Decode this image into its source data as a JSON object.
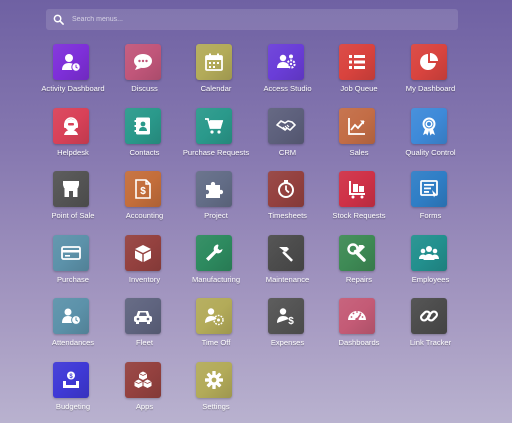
{
  "search": {
    "placeholder": "Search menus..."
  },
  "apps": [
    {
      "label": "Activity Dashboard",
      "icon": "activity-dashboard-icon",
      "color": "#7e2fd9"
    },
    {
      "label": "Discuss",
      "icon": "discuss-icon",
      "color": "#c1567a"
    },
    {
      "label": "Calendar",
      "icon": "calendar-icon",
      "color": "#b3ab59"
    },
    {
      "label": "Access Studio",
      "icon": "access-studio-icon",
      "color": "#6a3dd8"
    },
    {
      "label": "Job Queue",
      "icon": "job-queue-icon",
      "color": "#d9433e"
    },
    {
      "label": "My Dashboard",
      "icon": "my-dashboard-icon",
      "color": "#d9443f"
    },
    {
      "label": "Helpdesk",
      "icon": "helpdesk-icon",
      "color": "#d94158"
    },
    {
      "label": "Contacts",
      "icon": "contacts-icon",
      "color": "#2a998b"
    },
    {
      "label": "Purchase Requests",
      "icon": "purchase-requests-icon",
      "color": "#2a998b"
    },
    {
      "label": "CRM",
      "icon": "crm-icon",
      "color": "#5d607c"
    },
    {
      "label": "Sales",
      "icon": "sales-icon",
      "color": "#c36d46"
    },
    {
      "label": "Quality Control",
      "icon": "quality-control-icon",
      "color": "#3e8ad9"
    },
    {
      "label": "Point of Sale",
      "icon": "point-of-sale-icon",
      "color": "#545454"
    },
    {
      "label": "Accounting",
      "icon": "accounting-icon",
      "color": "#c46e3b"
    },
    {
      "label": "Project",
      "icon": "project-icon",
      "color": "#636d87"
    },
    {
      "label": "Timesheets",
      "icon": "timesheets-icon",
      "color": "#94413f"
    },
    {
      "label": "Stock Requests",
      "icon": "stock-requests-icon",
      "color": "#cf3147"
    },
    {
      "label": "Forms",
      "icon": "forms-icon",
      "color": "#2f7ec6"
    },
    {
      "label": "Purchase",
      "icon": "purchase-icon",
      "color": "#5c92aa"
    },
    {
      "label": "Inventory",
      "icon": "inventory-icon",
      "color": "#94413f"
    },
    {
      "label": "Manufacturing",
      "icon": "manufacturing-icon",
      "color": "#2d8a5f"
    },
    {
      "label": "Maintenance",
      "icon": "maintenance-icon",
      "color": "#4c4c4c"
    },
    {
      "label": "Repairs",
      "icon": "repairs-icon",
      "color": "#3e8a55"
    },
    {
      "label": "Employees",
      "icon": "employees-icon",
      "color": "#22908e"
    },
    {
      "label": "Attendances",
      "icon": "attendances-icon",
      "color": "#5c92aa"
    },
    {
      "label": "Fleet",
      "icon": "fleet-icon",
      "color": "#5f647f"
    },
    {
      "label": "Time Off",
      "icon": "time-off-icon",
      "color": "#b3ab59"
    },
    {
      "label": "Expenses",
      "icon": "expenses-icon",
      "color": "#545454"
    },
    {
      "label": "Dashboards",
      "icon": "dashboards-icon",
      "color": "#c45b76"
    },
    {
      "label": "Link Tracker",
      "icon": "link-tracker-icon",
      "color": "#4c4c4c"
    },
    {
      "label": "Budgeting",
      "icon": "budgeting-icon",
      "color": "#3f39d6"
    },
    {
      "label": "Apps",
      "icon": "apps-icon",
      "color": "#94413f"
    },
    {
      "label": "Settings",
      "icon": "settings-icon",
      "color": "#b3ab59"
    }
  ]
}
